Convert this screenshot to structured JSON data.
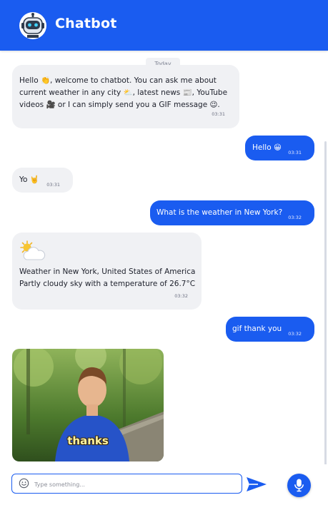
{
  "header": {
    "title": "Chatbot",
    "avatar_icon": "robot-icon",
    "color": "#1a5cf0"
  },
  "chat": {
    "date_divider": "Today",
    "messages": [
      {
        "from": "bot",
        "text": "Hello 👏, welcome to chatbot. You can ask me about current weather in any city ⛅, latest news 📰, YouTube videos 🎥 or I can simply send you a GIF message 😉.",
        "time": "03:31"
      },
      {
        "from": "user",
        "text": "Hello 😀",
        "time": "03:31"
      },
      {
        "from": "bot",
        "text": "Yo 🤘",
        "time": "03:31"
      },
      {
        "from": "user",
        "text": "What is the weather in New York?",
        "time": "03:32"
      },
      {
        "from": "bot",
        "icon": "partly-cloudy-icon",
        "line1": "Weather in New York, United States of America",
        "line2": "Partly cloudy sky with a temperature of 26.7°C",
        "time": "03:32"
      },
      {
        "from": "user",
        "text": "gif thank you",
        "time": "03:32"
      },
      {
        "from": "bot",
        "type": "gif",
        "caption": "thanks"
      }
    ]
  },
  "input": {
    "placeholder": "Type something...",
    "value": "",
    "emoji_icon": "smiley-icon",
    "send_icon": "send-icon",
    "mic_icon": "microphone-icon"
  }
}
